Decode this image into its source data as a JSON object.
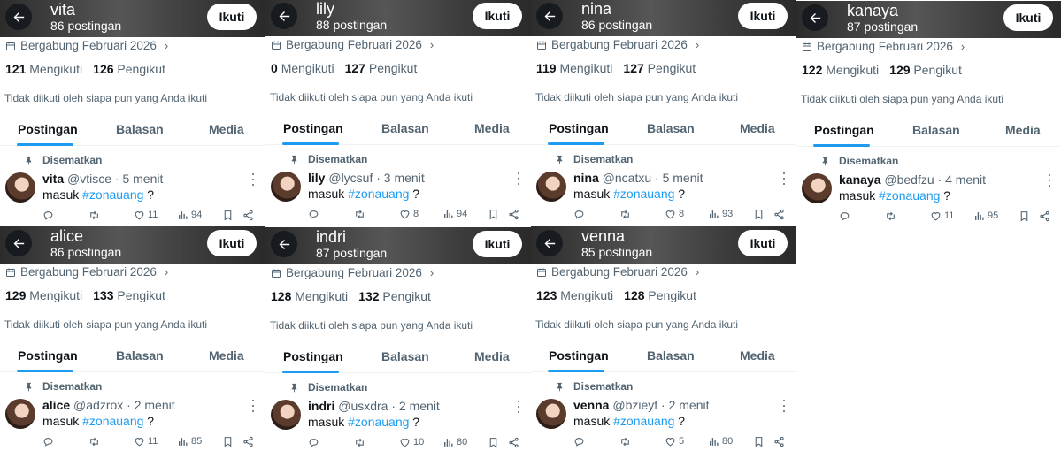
{
  "follow_label": "Ikuti",
  "joined_text": "Bergabung Februari 2026",
  "following_label": "Mengikuti",
  "followers_label": "Pengikut",
  "not_followed_text": "Tidak diikuti oleh siapa pun yang Anda ikuti",
  "tabs": [
    "Postingan",
    "Balasan",
    "Media"
  ],
  "pinned_label": "Disematkan",
  "tweet_text": "masuk",
  "hashtag": "#zonauang",
  "tweet_suffix": " ?",
  "accent_color": "#1d9bf0",
  "icons": {
    "back": "back-arrow-icon",
    "calendar": "calendar-icon",
    "pin": "pin-icon",
    "reply": "reply-icon",
    "retweet": "retweet-icon",
    "like": "heart-icon",
    "views": "views-icon",
    "bookmark": "bookmark-icon",
    "share": "share-icon"
  },
  "profiles": [
    {
      "name": "vita",
      "posts": "86 postingan",
      "following": "121",
      "followers": "126",
      "handle": "@vtisce",
      "time": "· 5 menit",
      "likes": "11",
      "views": "94"
    },
    {
      "name": "lily",
      "posts": "88 postingan",
      "following": "0",
      "followers": "127",
      "handle": "@lycsuf",
      "time": "· 3 menit",
      "likes": "8",
      "views": "94"
    },
    {
      "name": "nina",
      "posts": "86 postingan",
      "following": "119",
      "followers": "127",
      "handle": "@ncatxu",
      "time": "· 5 menit",
      "likes": "8",
      "views": "93"
    },
    {
      "name": "kanaya",
      "posts": "87 postingan",
      "following": "122",
      "followers": "129",
      "handle": "@bedfzu",
      "time": "· 4 menit",
      "likes": "11",
      "views": "95"
    },
    {
      "name": "alice",
      "posts": "86 postingan",
      "following": "129",
      "followers": "133",
      "handle": "@adzrox",
      "time": "· 2 menit",
      "likes": "11",
      "views": "85"
    },
    {
      "name": "indri",
      "posts": "87 postingan",
      "following": "128",
      "followers": "132",
      "handle": "@usxdra",
      "time": "· 2 menit",
      "likes": "10",
      "views": "80"
    },
    {
      "name": "venna",
      "posts": "85 postingan",
      "following": "123",
      "followers": "128",
      "handle": "@bzieyf",
      "time": "· 2 menit",
      "likes": "5",
      "views": "80"
    }
  ]
}
